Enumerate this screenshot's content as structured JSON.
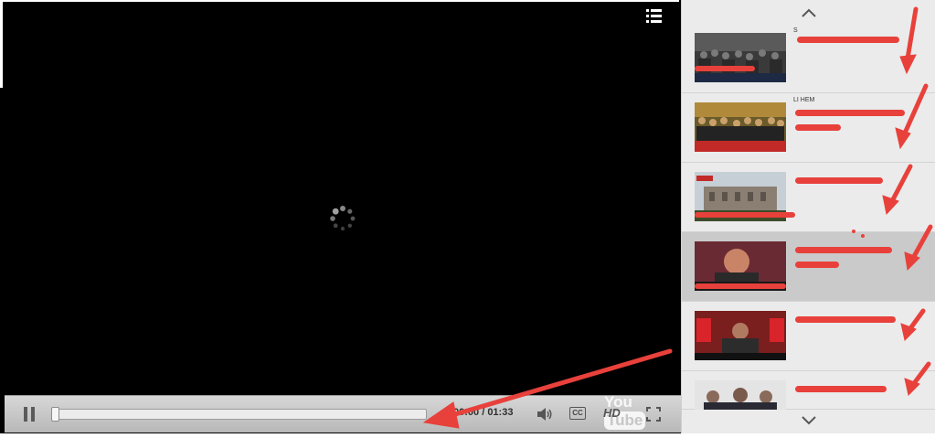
{
  "player": {
    "time_current": "00:00",
    "time_separator": " / ",
    "time_total": "01:33",
    "cc_label": "CC",
    "hd_label": "HD",
    "logo_you": "You",
    "logo_tube": "Tube",
    "progress_fraction": 0.0
  },
  "playlist": {
    "items": [
      {
        "title": "S",
        "active": false
      },
      {
        "title": "LI HEM",
        "active": false
      },
      {
        "title": "",
        "active": false
      },
      {
        "title": "",
        "active": true
      },
      {
        "title": "",
        "active": false
      },
      {
        "title": "",
        "active": false
      }
    ]
  },
  "colors": {
    "player_bg": "#000000",
    "sidebar_bg": "#ebebeb",
    "active_item_bg": "#cacaca",
    "annotation_red": "#e8413b"
  }
}
